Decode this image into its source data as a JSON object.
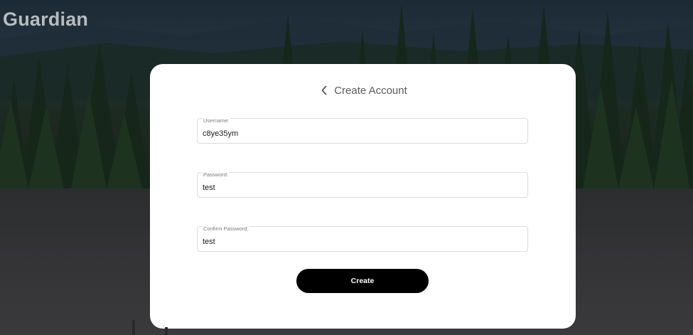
{
  "app": {
    "brand": "Guardian"
  },
  "form": {
    "title": "Create Account",
    "back_icon": "chevron-left-icon",
    "fields": [
      {
        "label": "Username:",
        "value": "c8ye35ym"
      },
      {
        "label": "Password:",
        "value": "test"
      },
      {
        "label": "Confirm Password:",
        "value": "test"
      }
    ],
    "submit_label": "Create"
  },
  "colors": {
    "card_background": "#ffffff",
    "button_background": "#000000",
    "button_text": "#ffffff",
    "brand_text": "#b7bcbf"
  }
}
